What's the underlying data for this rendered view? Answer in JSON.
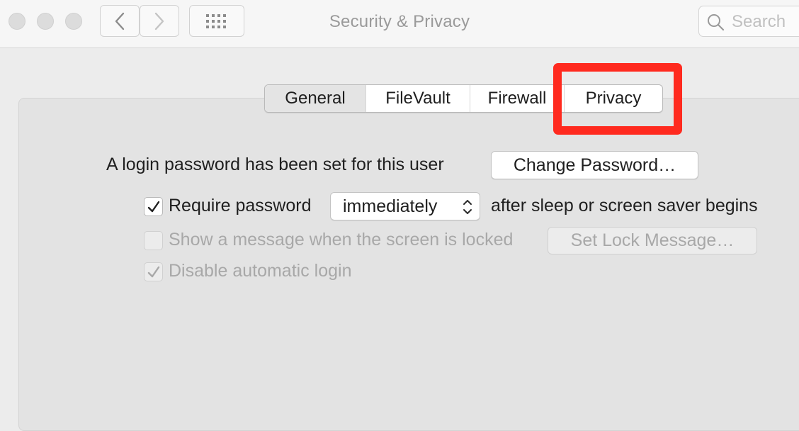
{
  "window": {
    "title": "Security & Privacy"
  },
  "toolbar": {
    "back_icon": "chevron-left-icon",
    "forward_icon": "chevron-right-icon",
    "grid_icon": "grid-icon",
    "search_placeholder": "Search"
  },
  "tabs": [
    {
      "label": "General",
      "selected": true
    },
    {
      "label": "FileVault",
      "selected": false
    },
    {
      "label": "Firewall",
      "selected": false
    },
    {
      "label": "Privacy",
      "selected": false
    }
  ],
  "highlight_color": "#ff2a1f",
  "general": {
    "login_password_text": "A login password has been set for this user",
    "change_password_label": "Change Password…",
    "require_password": {
      "label": "Require password",
      "checked": true
    },
    "require_password_value": "immediately",
    "require_password_suffix": "after sleep or screen saver begins",
    "show_message": {
      "label": "Show a message when the screen is locked",
      "checked": false,
      "enabled": false
    },
    "set_lock_message_label": "Set Lock Message…",
    "disable_auto_login": {
      "label": "Disable automatic login",
      "checked": true,
      "enabled": false
    }
  }
}
